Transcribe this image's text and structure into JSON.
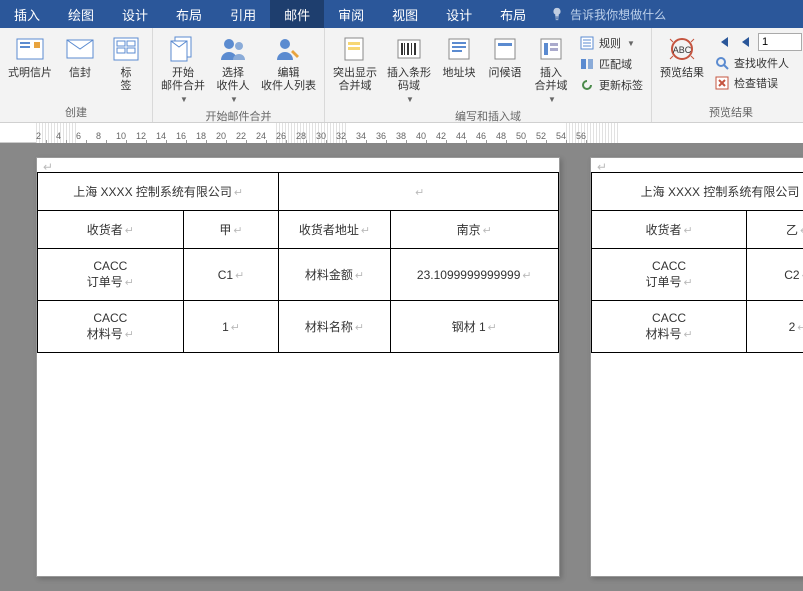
{
  "tabs": {
    "t0": "插入",
    "t1": "绘图",
    "t2": "设计",
    "t3": "布局",
    "t4": "引用",
    "t5": "邮件",
    "t6": "审阅",
    "t7": "视图",
    "t8": "设计",
    "t9": "布局"
  },
  "tellme": "告诉我你想做什么",
  "ribbon": {
    "postcard": "式明信片",
    "envelope": "信封",
    "labels": "标\n签",
    "start": "开始\n邮件合并",
    "select": "选择\n收件人",
    "edit": "编辑\n收件人列表",
    "g1": "创建",
    "g2": "开始邮件合并",
    "highlight": "突出显示\n合并域",
    "barcode": "插入条形\n码域",
    "address": "地址块",
    "greeting": "问候语",
    "insert": "插入\n合并域",
    "rules": "规则",
    "match": "匹配域",
    "update": "更新标签",
    "g3": "编写和插入域",
    "preview": "预览结果",
    "find": "查找收件人",
    "check": "检查错误",
    "g4": "预览结果",
    "rec": "1"
  },
  "doc": {
    "title": "上海 XXXX 控制系统有限公司",
    "recipient_l": "收货者",
    "party_a": "甲",
    "addr_l": "收货者地址",
    "addr_v": "南京",
    "order_l": "CACC\n订单号",
    "order_v": "C1",
    "amt_l": "材料金额",
    "amt_v": "23.1099999999999",
    "mat_l": "CACC\n材料号",
    "mat_v": "1",
    "name_l": "材料名称",
    "name_v": "钢材 1",
    "party_b": "乙",
    "order_v2": "C2",
    "mat_v2": "2"
  }
}
